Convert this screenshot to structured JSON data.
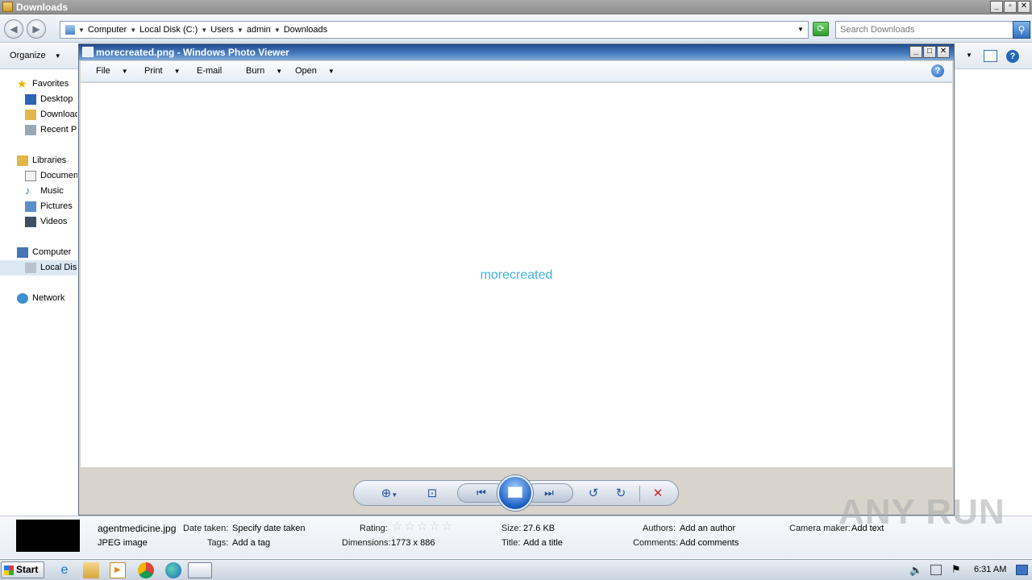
{
  "explorer": {
    "title": "Downloads",
    "breadcrumbs": [
      "Computer",
      "Local Disk (C:)",
      "Users",
      "admin",
      "Downloads"
    ],
    "search_placeholder": "Search Downloads",
    "organize_label": "Organize"
  },
  "nav_pane": {
    "favorites_label": "Favorites",
    "favorites": [
      "Desktop",
      "Downloads",
      "Recent Places"
    ],
    "libraries_label": "Libraries",
    "libraries": [
      "Documents",
      "Music",
      "Pictures",
      "Videos"
    ],
    "computer_label": "Computer",
    "computer_items": [
      "Local Disk (C:)"
    ],
    "network_label": "Network"
  },
  "photo_viewer": {
    "title": "morecreated.png - Windows Photo Viewer",
    "menu": [
      "File",
      "Print",
      "E-mail",
      "Burn",
      "Open"
    ],
    "image_text": "morecreated",
    "help_label": "?"
  },
  "details": {
    "filename": "agentmedicine.jpg",
    "filetype": "JPEG image",
    "date_taken_label": "Date taken:",
    "date_taken_value": "Specify date taken",
    "tags_label": "Tags:",
    "tags_value": "Add a tag",
    "rating_label": "Rating:",
    "rating_value": 0,
    "dimensions_label": "Dimensions:",
    "dimensions_value": "1773 x 886",
    "size_label": "Size:",
    "size_value": "27.6 KB",
    "title_label": "Title:",
    "title_value": "Add a title",
    "authors_label": "Authors:",
    "authors_value": "Add an author",
    "comments_label": "Comments:",
    "comments_value": "Add comments",
    "camera_label": "Camera maker:",
    "camera_value": "Add text"
  },
  "taskbar": {
    "start_label": "Start",
    "clock": "6:31 AM"
  },
  "watermark": "ANY RUN"
}
